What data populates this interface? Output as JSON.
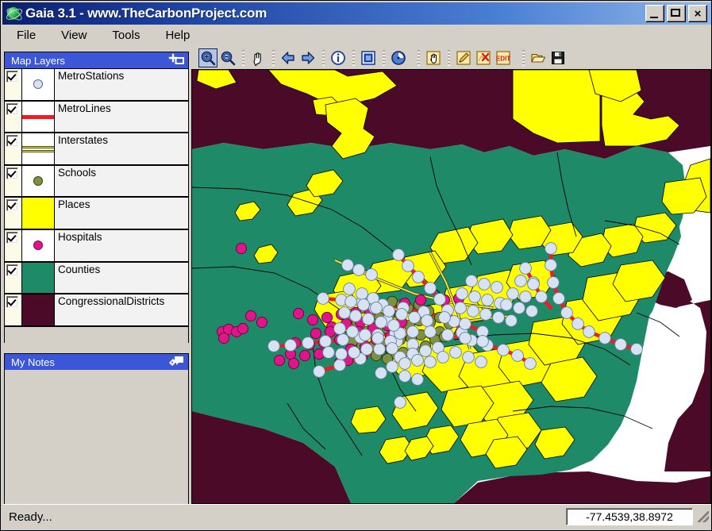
{
  "window": {
    "title": "Gaia 3.1 - www.TheCarbonProject.com",
    "app_icon": "globe-icon",
    "minimize_label": "_",
    "maximize_label": "□",
    "close_label": "×",
    "accent_title_bg": "#0a1f6e",
    "panel_header_bg": "#3b57d8",
    "chrome_bg": "#d4d0c8"
  },
  "menu": {
    "items": [
      {
        "label": "File",
        "name": "menu-file"
      },
      {
        "label": "View",
        "name": "menu-view"
      },
      {
        "label": "Tools",
        "name": "menu-tools"
      },
      {
        "label": "Help",
        "name": "menu-help"
      }
    ]
  },
  "toolbar": {
    "buttons": [
      {
        "icon": "zoom-in-icon",
        "label": "Zoom In",
        "active": true
      },
      {
        "icon": "zoom-out-icon",
        "label": "Zoom Out",
        "active": false
      },
      {
        "sep": true
      },
      {
        "icon": "pan-hand-icon",
        "label": "Pan",
        "active": false
      },
      {
        "sep": true
      },
      {
        "icon": "arrow-left-icon",
        "label": "Previous Extent",
        "active": false
      },
      {
        "icon": "arrow-right-icon",
        "label": "Next Extent",
        "active": false
      },
      {
        "sep": true
      },
      {
        "icon": "info-icon",
        "label": "Identify",
        "active": false
      },
      {
        "sep": true
      },
      {
        "icon": "full-extent-icon",
        "label": "Full Extent",
        "active": false
      },
      {
        "sep": true
      },
      {
        "icon": "refresh-icon",
        "label": "Refresh",
        "active": false
      },
      {
        "gap": true
      },
      {
        "sep": true
      },
      {
        "icon": "select-hand-icon",
        "label": "Select Features",
        "active": false
      },
      {
        "sep": true
      },
      {
        "icon": "pencil-edit-icon",
        "label": "Edit Feature",
        "active": false
      },
      {
        "icon": "delete-feature-icon",
        "label": "Delete Feature",
        "active": false
      },
      {
        "icon": "edit-mode-icon",
        "label": "EDIT Mode",
        "active": false
      },
      {
        "gap": true
      },
      {
        "sep": true
      },
      {
        "icon": "open-folder-icon",
        "label": "Open",
        "active": false
      },
      {
        "icon": "save-disk-icon",
        "label": "Save",
        "active": false
      }
    ]
  },
  "layers_panel": {
    "title": "Map Layers",
    "header_icon": "add-layer-icon",
    "layers": [
      {
        "label": "MetroStations",
        "checked": true,
        "symbol": "point",
        "color": "#d7e3f4",
        "stroke": "#5a6b80"
      },
      {
        "label": "MetroLines",
        "checked": true,
        "symbol": "line",
        "color": "#ee1c24",
        "stroke": "#b00000"
      },
      {
        "label": "Interstates",
        "checked": true,
        "symbol": "dblline",
        "color": "#f2ec52",
        "stroke": "#4a4a00"
      },
      {
        "label": "Schools",
        "checked": true,
        "symbol": "point",
        "color": "#7d9140",
        "stroke": "#3a4418"
      },
      {
        "label": "Places",
        "checked": true,
        "symbol": "polygon",
        "color": "#ffff00",
        "stroke": "#000000"
      },
      {
        "label": "Hospitals",
        "checked": true,
        "symbol": "point",
        "color": "#df1589",
        "stroke": "#7a0a4a"
      },
      {
        "label": "Counties",
        "checked": true,
        "symbol": "polygon",
        "color": "#1f8a67",
        "stroke": "#000000"
      },
      {
        "label": "CongressionalDistricts",
        "checked": true,
        "symbol": "polygon",
        "color": "#4b0a28",
        "stroke": "#000000"
      }
    ]
  },
  "notes_panel": {
    "title": "My Notes",
    "header_icon": "note-tag-icon",
    "content": ""
  },
  "statusbar": {
    "message": "Ready...",
    "coordinates": "-77.4539,38.8972",
    "resize_grip": "resize-grip-icon"
  },
  "map": {
    "colors": {
      "water": "#ffffff",
      "counties": "#1f8a67",
      "places": "#ffff00",
      "districts": "#4b0a28",
      "metro_line": "#ee1c24",
      "metro_station": "#d7e3f4",
      "hospital": "#df1589",
      "school": "#7d9140",
      "boundary": "#000000"
    },
    "center_coordinates": "-77.4539,38.8972"
  }
}
